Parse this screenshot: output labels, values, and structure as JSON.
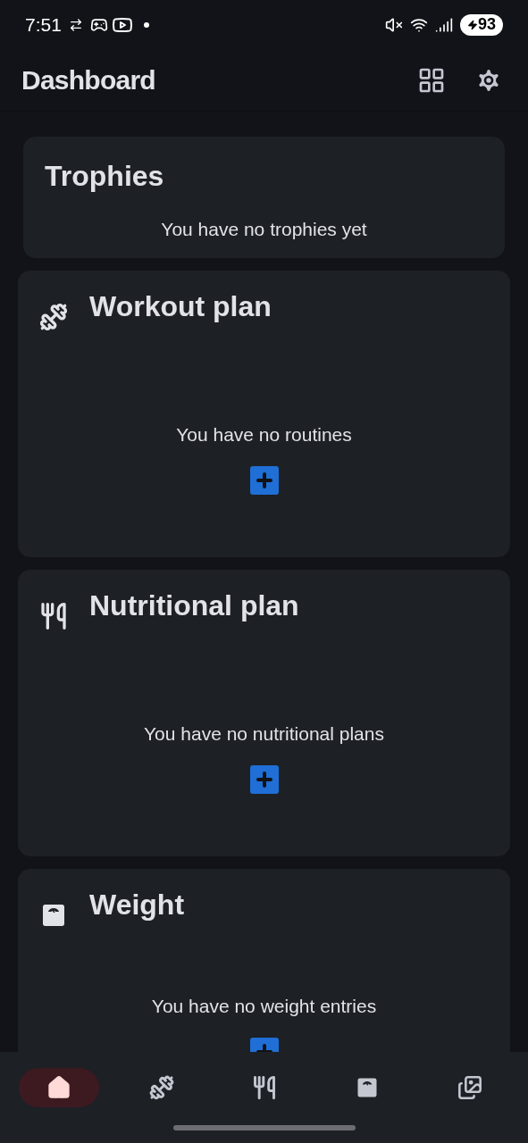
{
  "status_bar": {
    "time": "7:51",
    "battery": "93"
  },
  "app_bar": {
    "title": "Dashboard"
  },
  "cards": [
    {
      "kind": "trophies",
      "title": "Trophies",
      "message": "You have no trophies yet"
    },
    {
      "kind": "workout",
      "title": "Workout plan",
      "message": "You have no routines"
    },
    {
      "kind": "nutrition",
      "title": "Nutritional plan",
      "message": "You have no nutritional plans"
    },
    {
      "kind": "weight",
      "title": "Weight",
      "message": "You have no weight entries"
    }
  ],
  "nav": [
    {
      "kind": "home",
      "selected": true
    },
    {
      "kind": "workout",
      "selected": false
    },
    {
      "kind": "nutrition",
      "selected": false
    },
    {
      "kind": "weight",
      "selected": false
    },
    {
      "kind": "gallery",
      "selected": false
    }
  ]
}
